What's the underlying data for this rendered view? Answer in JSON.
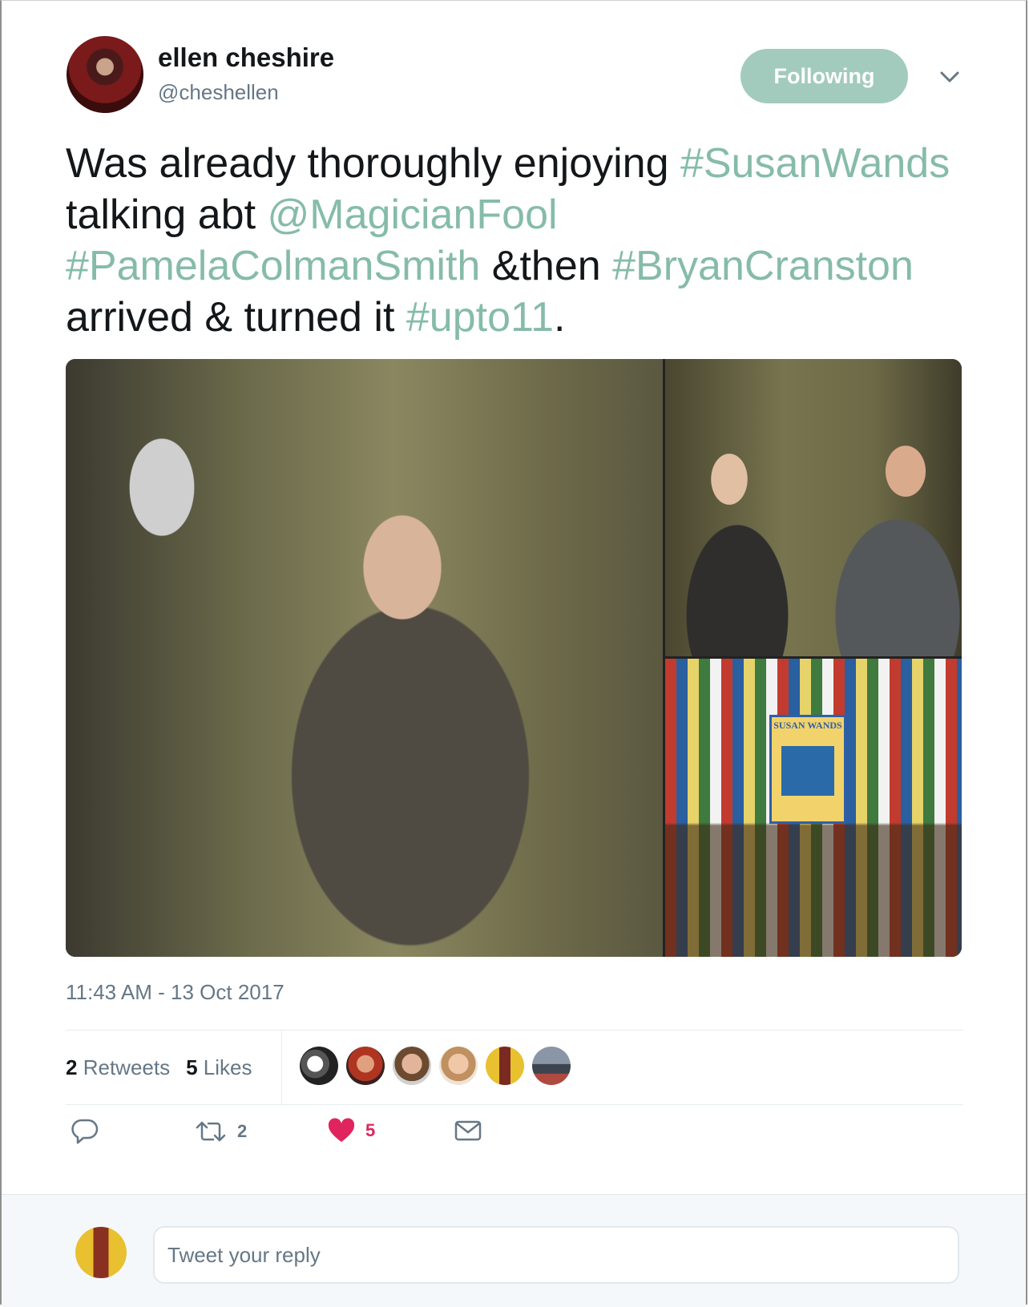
{
  "author": {
    "name": "ellen cheshire",
    "handle": "@cheshellen",
    "follow_label": "Following"
  },
  "tweet": {
    "segments": [
      {
        "text": "Was already thoroughly enjoying ",
        "type": "text"
      },
      {
        "text": "#SusanWands",
        "type": "tag"
      },
      {
        "text": " talking abt ",
        "type": "text"
      },
      {
        "text": "@MagicianFool",
        "type": "tag"
      },
      {
        "text": " ",
        "type": "text"
      },
      {
        "text": "#PamelaColmanSmith",
        "type": "tag"
      },
      {
        "text": " &then ",
        "type": "text"
      },
      {
        "text": "#BryanCranston",
        "type": "tag"
      },
      {
        "text": " arrived & turned it ",
        "type": "text"
      },
      {
        "text": "#upto11",
        "type": "tag"
      },
      {
        "text": ".",
        "type": "text"
      }
    ],
    "timestamp": "11:43 AM - 13 Oct 2017",
    "poster_text": "SUSAN WANDS"
  },
  "stats": {
    "retweets_count": "2",
    "retweets_label": "Retweets",
    "likes_count": "5",
    "likes_label": "Likes"
  },
  "actions": {
    "retweet_count": "2",
    "like_count": "5"
  },
  "reply": {
    "placeholder": "Tweet your reply"
  },
  "colors": {
    "hashtag": "#86bbaa",
    "follow_button": "#a2cbbd",
    "like": "#e0245e"
  }
}
